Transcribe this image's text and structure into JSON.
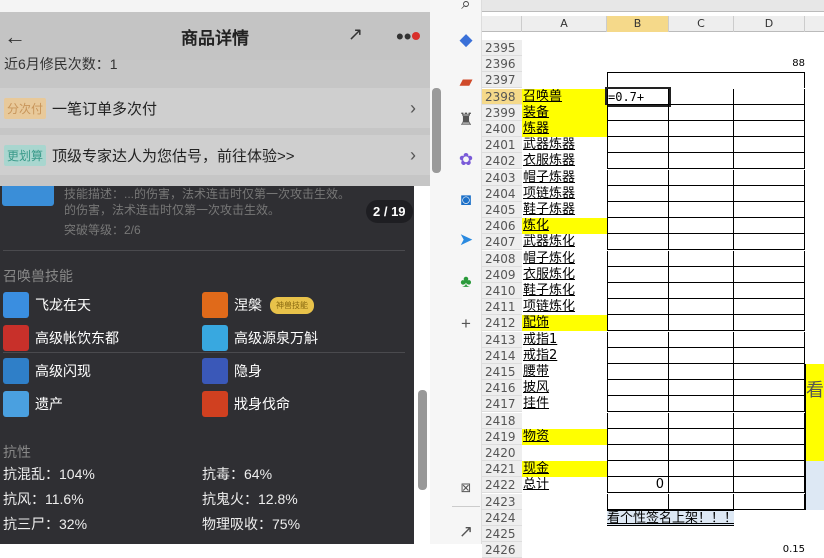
{
  "phone": {
    "title": "商品详情",
    "partial_text": "近6月修民次数：1",
    "rows": [
      {
        "tag": "分次付",
        "tag_color": "#e8c99a",
        "text": "一笔订单多次付"
      },
      {
        "tag": "更划算",
        "tag_color": "#a9d6cf",
        "text": "顶级专家达人为您估号，前往体验>>"
      }
    ],
    "skill_desc": [
      "技能描述：...的伤害，法术连击时仅第一次攻击生效。",
      "的伤害，法术连击时仅第一次攻击生效。",
      "突破等级：2/6"
    ],
    "pager": "2 / 19",
    "skills_title": "召唤兽技能",
    "skills": [
      {
        "name": "飞龙在天",
        "color": "#3a8ee0"
      },
      {
        "name": "涅槃",
        "color": "#e06a1a",
        "badge": "神兽技能"
      },
      {
        "name": "高级帐饮东都",
        "color": "#c8302a"
      },
      {
        "name": "高级源泉万斛",
        "color": "#38a8e0"
      },
      {
        "name": "高级闪现",
        "color": "#2f7fc8"
      },
      {
        "name": "隐身",
        "color": "#3a58b8"
      },
      {
        "name": "遗产",
        "color": "#4aa0e0"
      },
      {
        "name": "戕身伐命",
        "color": "#d04020"
      }
    ],
    "resist_title": "抗性",
    "resists": [
      "抗混乱：104%",
      "抗毒：64%",
      "抗风：11.6%",
      "抗鬼火：12.8%",
      "抗三尸：32%",
      "物理吸收：75%"
    ]
  },
  "sheet": {
    "columns": [
      "A",
      "B",
      "C",
      "D"
    ],
    "rows": [
      {
        "n": "2395",
        "a": ""
      },
      {
        "n": "2396",
        "a": "",
        "d": "88"
      },
      {
        "n": "2397",
        "a": ""
      },
      {
        "n": "2398",
        "a": "召唤兽",
        "y": true,
        "b": "=0.7+"
      },
      {
        "n": "2399",
        "a": "装备",
        "y": true
      },
      {
        "n": "2400",
        "a": "炼器",
        "y": true
      },
      {
        "n": "2401",
        "a": "武器炼器"
      },
      {
        "n": "2402",
        "a": "衣服炼器"
      },
      {
        "n": "2403",
        "a": "帽子炼器"
      },
      {
        "n": "2404",
        "a": "项链炼器"
      },
      {
        "n": "2405",
        "a": "鞋子炼器"
      },
      {
        "n": "2406",
        "a": "炼化",
        "y": true
      },
      {
        "n": "2407",
        "a": "武器炼化"
      },
      {
        "n": "2408",
        "a": "帽子炼化"
      },
      {
        "n": "2409",
        "a": "衣服炼化"
      },
      {
        "n": "2410",
        "a": "鞋子炼化"
      },
      {
        "n": "2411",
        "a": "项链炼化"
      },
      {
        "n": "2412",
        "a": "配饰",
        "y": true
      },
      {
        "n": "2413",
        "a": "戒指1"
      },
      {
        "n": "2414",
        "a": "戒指2"
      },
      {
        "n": "2415",
        "a": "腰带"
      },
      {
        "n": "2416",
        "a": "披风"
      },
      {
        "n": "2417",
        "a": "挂件"
      },
      {
        "n": "2418",
        "a": ""
      },
      {
        "n": "2419",
        "a": "物资",
        "y": true
      },
      {
        "n": "2420",
        "a": ""
      },
      {
        "n": "2421",
        "a": "现金",
        "y": true
      },
      {
        "n": "2422",
        "a": "总计",
        "b": "0"
      },
      {
        "n": "2423",
        "a": ""
      },
      {
        "n": "2424",
        "a": "",
        "bc": "看个性签名上架！！！"
      },
      {
        "n": "2425",
        "a": ""
      },
      {
        "n": "2426",
        "a": "",
        "d": "0.15"
      }
    ],
    "side_text": "看"
  }
}
